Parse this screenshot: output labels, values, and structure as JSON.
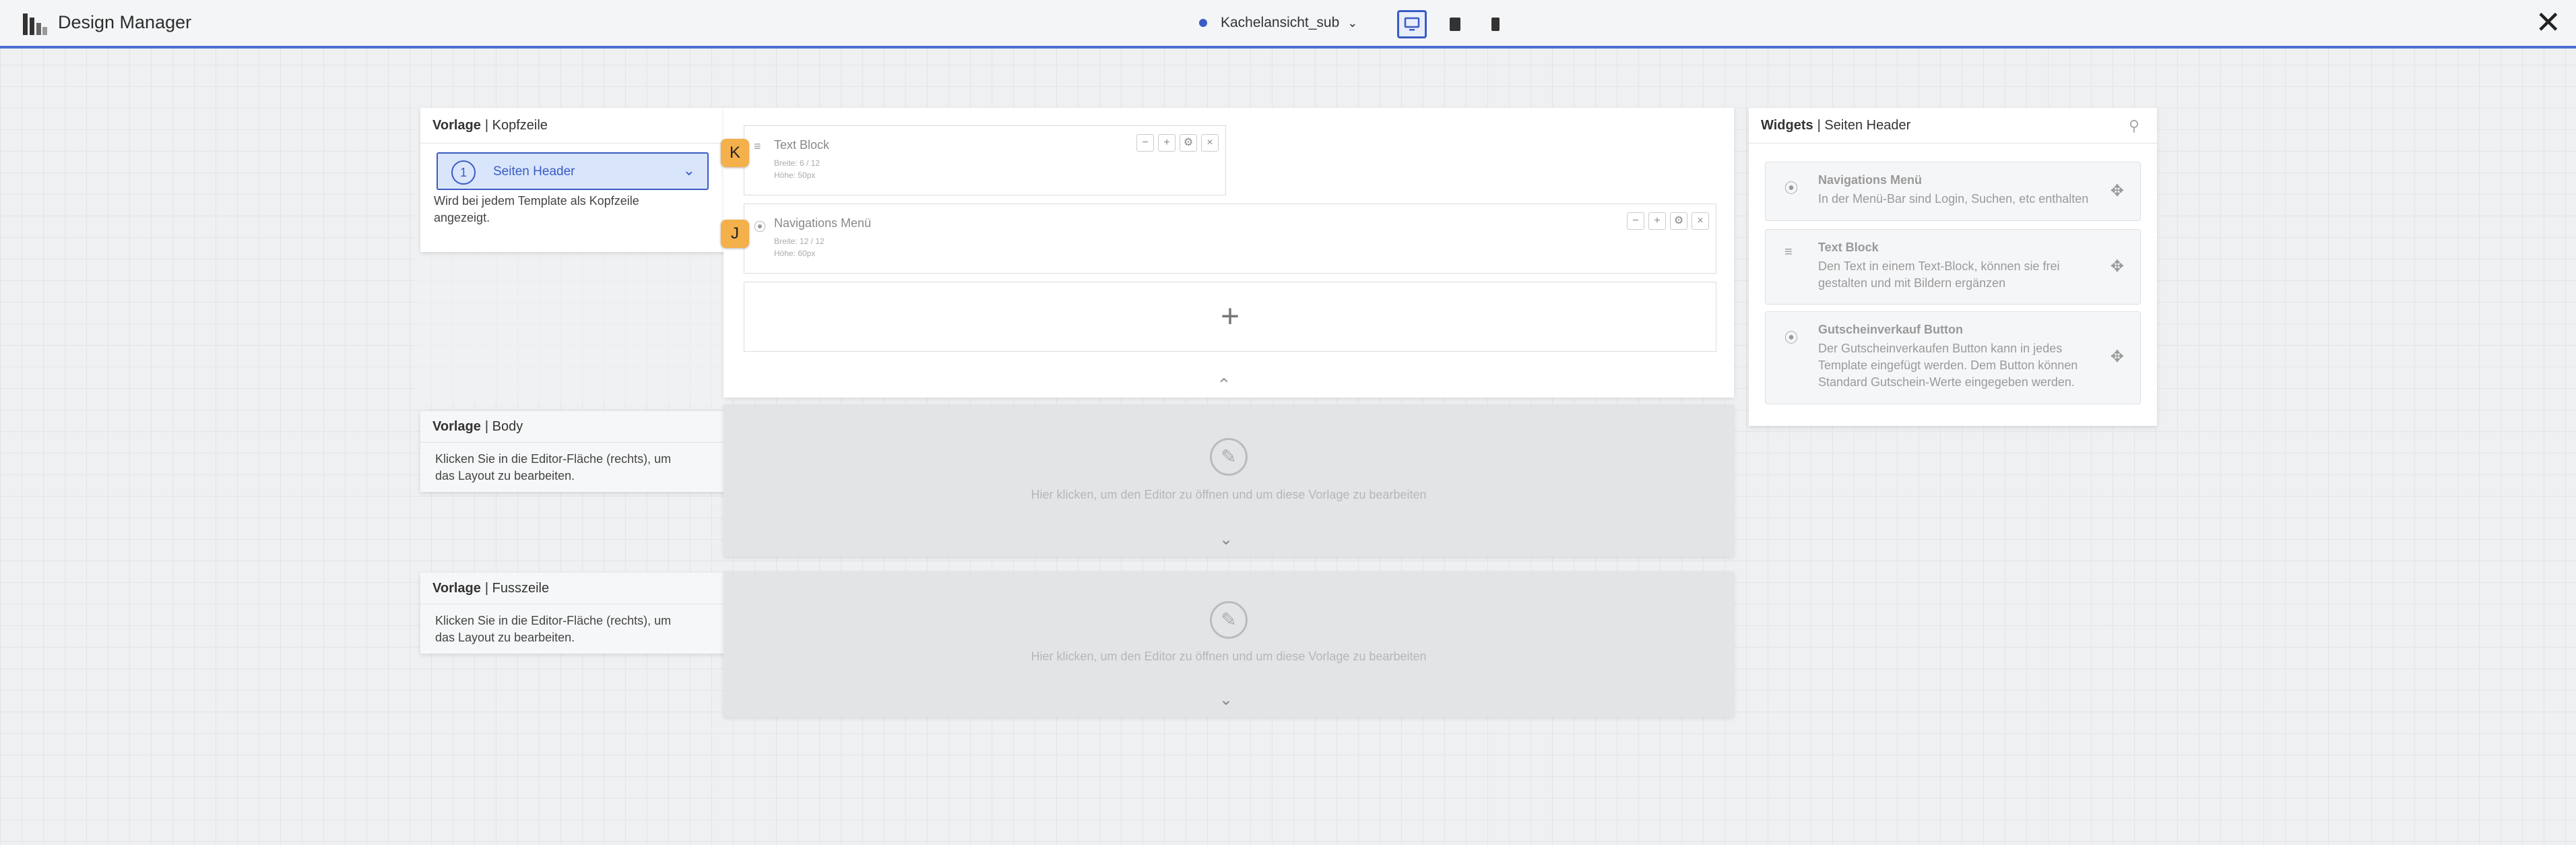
{
  "header": {
    "app_title": "Design Manager",
    "view_name": "Kachelansicht_sub",
    "icons": [
      "desktop-icon",
      "tablet-icon",
      "mobile-icon",
      "close-icon"
    ]
  },
  "templates": {
    "kopfzeile": {
      "label": "Vorlage",
      "name": "Kopfzeile",
      "section_number": "1",
      "section_label": "Seiten Header",
      "description": "Wird bei jedem Template als Kopfzeile angezeigt."
    },
    "body": {
      "label": "Vorlage",
      "name": "Body",
      "description": "Klicken Sie in die Editor-Fläche (rechts), um das Layout zu bearbeiten."
    },
    "fusszeile": {
      "label": "Vorlage",
      "name": "Fusszeile",
      "description": "Klicken Sie in die Editor-Fläche (rechts), um das Layout zu bearbeiten."
    }
  },
  "editor": {
    "blocks": [
      {
        "title": "Text Block",
        "width": "Breite: 6 / 12",
        "height": "Höhe: 50px",
        "tag": "K"
      },
      {
        "title": "Navigations Menü",
        "width": "Breite: 12 / 12",
        "height": "Höhe: 60px",
        "tag": "J"
      }
    ],
    "add_symbol": "+",
    "open_hint": "Hier klicken, um den Editor zu öffnen und um diese Vorlage zu bearbeiten"
  },
  "widgets": {
    "label": "Widgets",
    "name": "Seiten Header",
    "items": [
      {
        "title": "Navigations Menü",
        "description": "In der Menü-Bar sind Login, Suchen, etc enthalten",
        "icon": "compass-icon"
      },
      {
        "title": "Text Block",
        "description": "Den Text in einem Text-Block, können sie frei gestalten und mit Bildern ergänzen",
        "icon": "text-align-icon"
      },
      {
        "title": "Gutscheinverkauf Button",
        "description": "Der Gutscheinverkaufen Button kann in jedes Template eingefügt werden. Dem Button können Standard Gutschein-Werte eingegeben werden.",
        "icon": "gift-icon"
      }
    ]
  },
  "colors": {
    "accent": "#3a5cc4",
    "tag": "#f4b04a"
  }
}
